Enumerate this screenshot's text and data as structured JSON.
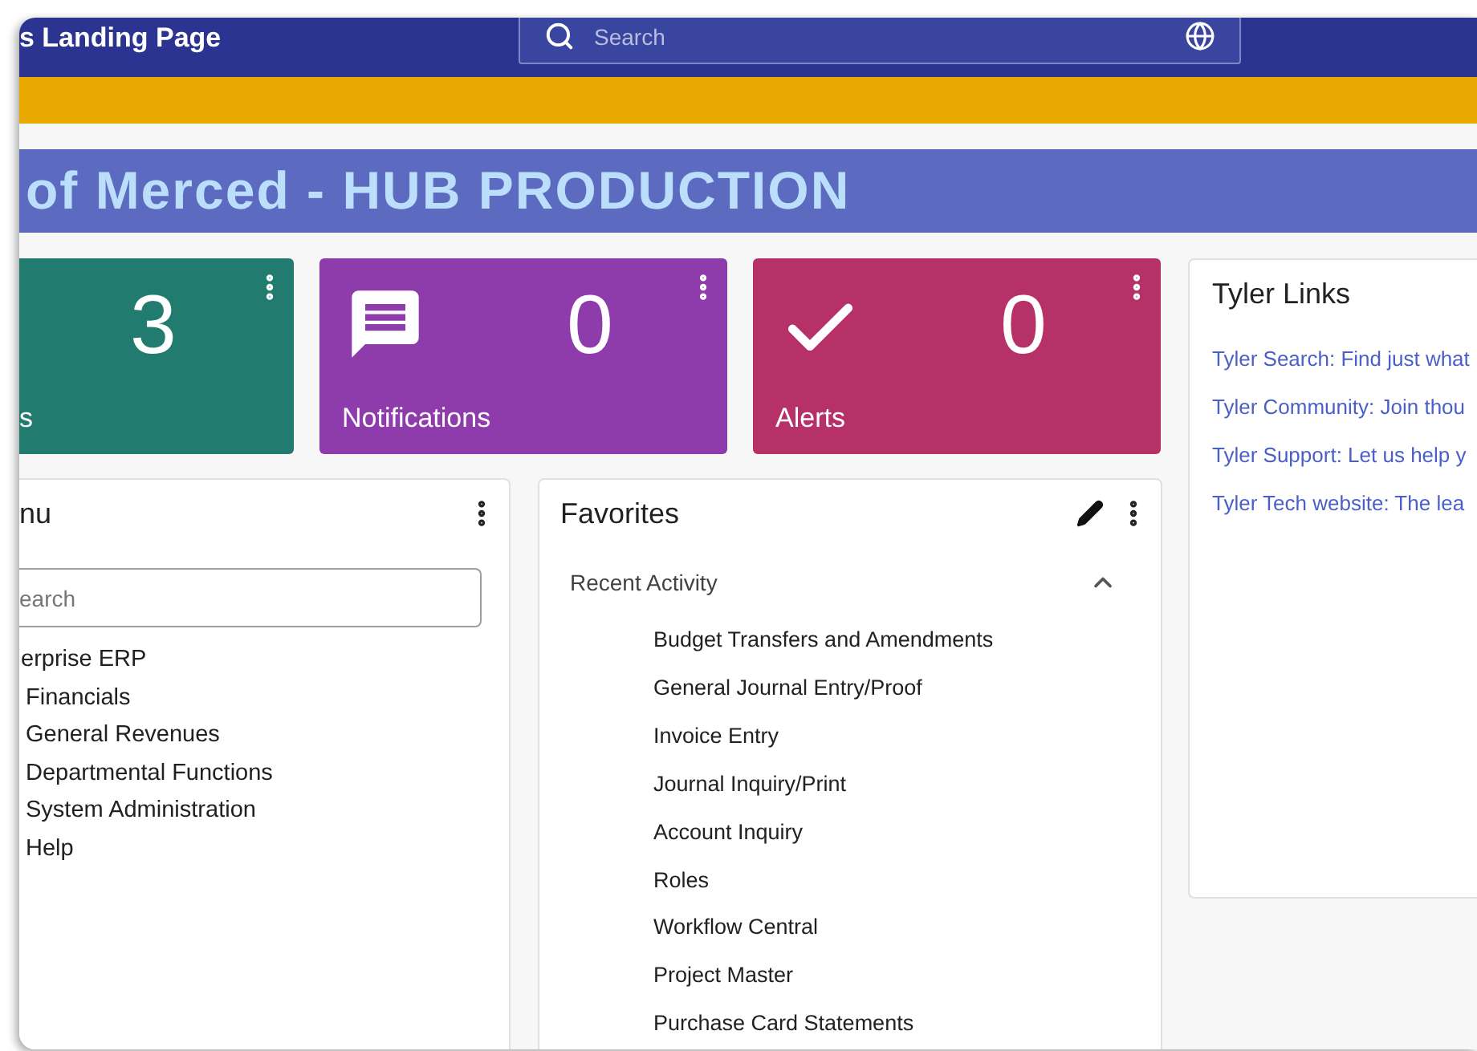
{
  "header": {
    "title": "s Landing Page",
    "search": {
      "placeholder": "Search"
    }
  },
  "banner": {
    "title": "of Merced - HUB PRODUCTION"
  },
  "tiles": [
    {
      "kind": "plain",
      "count": "3",
      "label": "s",
      "color": "#227b6f"
    },
    {
      "kind": "message",
      "count": "0",
      "label": "Notifications",
      "color": "#8e3bab"
    },
    {
      "kind": "check",
      "count": "0",
      "label": "Alerts",
      "color": "#b73169"
    }
  ],
  "menu": {
    "title": "nu",
    "search": {
      "placeholder": "earch"
    },
    "items": [
      {
        "label": "erprise ERP",
        "children": [
          {
            "label": "Financials"
          },
          {
            "label": "General Revenues"
          },
          {
            "label": "Departmental Functions"
          },
          {
            "label": "System Administration"
          },
          {
            "label": "Help"
          }
        ]
      }
    ]
  },
  "favorites": {
    "title": "Favorites",
    "section": {
      "label": "Recent Activity",
      "expanded": true,
      "items": [
        "Budget Transfers and Amendments",
        "General Journal Entry/Proof",
        "Invoice Entry",
        "Journal Inquiry/Print",
        "Account Inquiry",
        "Roles",
        "Workflow Central",
        "Project Master",
        "Purchase Card Statements"
      ]
    }
  },
  "links": {
    "title": "Tyler Links",
    "items": [
      "Tyler Search: Find just what",
      "Tyler Community: Join thou",
      "Tyler Support: Let us help y",
      "Tyler Tech website: The lea"
    ]
  }
}
